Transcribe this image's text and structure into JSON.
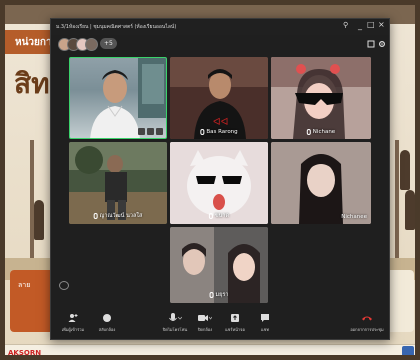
{
  "slide": {
    "tab_label": "หน่วยกา",
    "heading": "สิทธิ",
    "card_text": "ลาย",
    "logo_text": "AKSORN"
  },
  "window": {
    "title": "ม.3/1ห้องเรียน | ชุมนุมคณิตศาสตร์ (ห้องเรียนออนไลน์)",
    "controls": [
      "minimize",
      "maximize",
      "close"
    ]
  },
  "participants_count": "+5",
  "participants": [
    {
      "id": "self",
      "name": ""
    },
    {
      "id": "p2",
      "name": "Bas Rarong"
    },
    {
      "id": "p3",
      "name": "Nichane"
    },
    {
      "id": "p4",
      "name": "ญาณวัฒน์ นวลใส"
    },
    {
      "id": "p5",
      "name": "ขนาด"
    },
    {
      "id": "p6",
      "name": "Nichanee"
    },
    {
      "id": "p7",
      "name": "มยุรา"
    }
  ],
  "toolbar": [
    {
      "id": "invite",
      "label": "เพิ่มผู้เข้าร่วม",
      "icon": "add-person-icon"
    },
    {
      "id": "camera-flip",
      "label": "สลับกล้อง",
      "icon": "camera-icon"
    },
    {
      "id": "mic",
      "label": "ปิดไมโครโฟน",
      "icon": "mic-icon"
    },
    {
      "id": "video",
      "label": "ปิดกล้อง",
      "icon": "video-icon"
    },
    {
      "id": "share",
      "label": "แชร์หน้าจอ",
      "icon": "share-icon"
    },
    {
      "id": "more",
      "label": "แชท",
      "icon": "chat-icon"
    },
    {
      "id": "leave",
      "label": "ออกจากการประชุม",
      "icon": "hangup-icon"
    }
  ],
  "colors": {
    "window_bg": "#1f1f1f",
    "active_speaker_border": "#3bd26b",
    "hangup": "#e53935",
    "slide_accent": "#b55d2a"
  }
}
